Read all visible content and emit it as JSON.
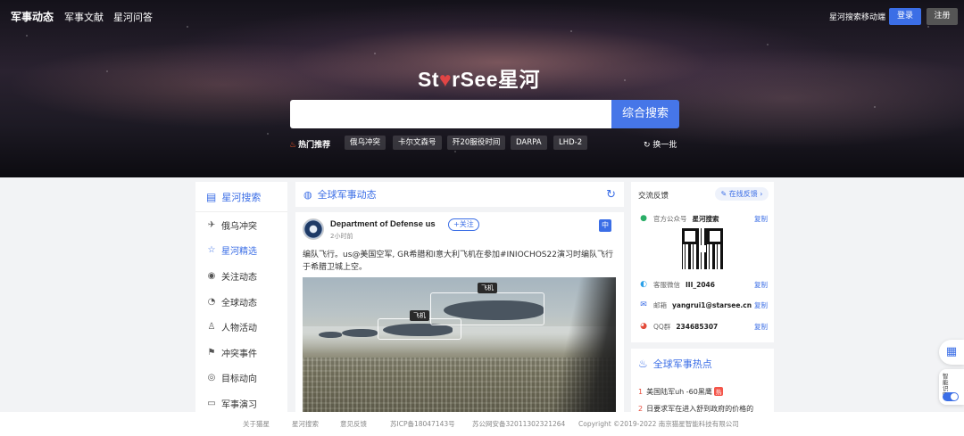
{
  "nav": {
    "items": [
      "军事动态",
      "军事文献",
      "星河问答"
    ],
    "mobile_link": "星河搜索移动端",
    "login": "登录",
    "register": "注册"
  },
  "hero": {
    "logo_latin": "St",
    "logo_pin": "♥",
    "logo_rest": "rSee",
    "logo_cn": "星河",
    "search_placeholder": "",
    "search_button": "综合搜索",
    "hot_label": "热门推荐",
    "hot_tags": [
      "俄乌冲突",
      "卡尔文森号",
      "歼20服役时间",
      "DARPA",
      "LHD-2"
    ],
    "refresh": "换一批"
  },
  "sidebar": {
    "title": "星河搜索",
    "items": [
      {
        "label": "俄乌冲突",
        "icon": "rocket-icon"
      },
      {
        "label": "星河精选",
        "icon": "star-pick-icon",
        "active": true
      },
      {
        "label": "关注动态",
        "icon": "broadcast-icon"
      },
      {
        "label": "全球动态",
        "icon": "compass-icon"
      },
      {
        "label": "人物活动",
        "icon": "person-icon"
      },
      {
        "label": "冲突事件",
        "icon": "flag-icon"
      },
      {
        "label": "目标动向",
        "icon": "location-icon"
      },
      {
        "label": "军事演习",
        "icon": "exercise-icon"
      }
    ]
  },
  "feed": {
    "title": "全球军事动态",
    "post": {
      "author": "Department of Defense us",
      "follow": "+关注",
      "time": "2小时前",
      "lang": "中",
      "text": "编队飞行。us@美国空军, GR希腊和I意大利飞机在参加#INIOCHOS22演习时编队飞行于希腊卫城上空。",
      "labels": [
        "飞机",
        "飞机"
      ]
    }
  },
  "contact": {
    "title": "交流反馈",
    "feedback_button": "在线反馈",
    "rows": [
      {
        "icon": "wechat-icon",
        "label": "官方公众号",
        "value": "星河搜索",
        "copy": "复制"
      },
      {
        "icon": "service-icon",
        "label": "客服微信",
        "value": "III_2046",
        "copy": "复制"
      },
      {
        "icon": "mail-icon",
        "label": "邮箱",
        "value": "yangrui1@starsee.cn",
        "copy": "复制"
      },
      {
        "icon": "qq-icon",
        "label": "QQ群",
        "value": "234685307",
        "copy": "复制"
      }
    ]
  },
  "hot": {
    "title": "全球军事热点",
    "items": [
      {
        "num": "1",
        "text": "美国陆军uh -60黑鹰",
        "badge": "热"
      },
      {
        "num": "2",
        "text": "日要求军在进入舒到政府的价格的"
      }
    ]
  },
  "floating": {
    "ai_label": "智能识图"
  },
  "footer": {
    "links": [
      "关于猫星",
      "星河搜索",
      "意见反馈",
      "苏ICP备18047143号",
      "苏公网安备32011302321264"
    ],
    "copyright": "Copyright ©2019-2022 南京猫星智能科技有限公司"
  },
  "colors": {
    "accent": "#3b6ee6",
    "hot_badge": "#f4554a"
  }
}
